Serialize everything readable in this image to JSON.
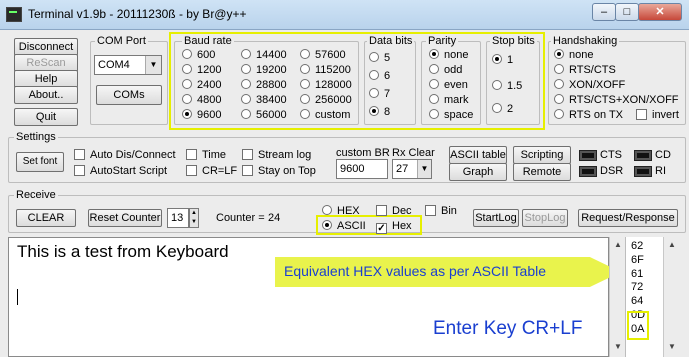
{
  "window": {
    "title": "Terminal v1.9b - 20111230ß - by Br@y++",
    "min": "–",
    "max": "□",
    "close": "✕"
  },
  "left_buttons": {
    "disconnect": "Disconnect",
    "rescan": "ReScan",
    "help": "Help",
    "about": "About..",
    "quit": "Quit"
  },
  "com_port": {
    "label": "COM Port",
    "value": "COM4",
    "coms_button": "COMs"
  },
  "baud": {
    "label": "Baud rate",
    "options": [
      "600",
      "1200",
      "2400",
      "4800",
      "9600",
      "14400",
      "19200",
      "28800",
      "38400",
      "56000",
      "57600",
      "115200",
      "128000",
      "256000",
      "custom"
    ],
    "selected": "9600"
  },
  "data_bits": {
    "label": "Data bits",
    "options": [
      "5",
      "6",
      "7",
      "8"
    ],
    "selected": "8"
  },
  "parity": {
    "label": "Parity",
    "options": [
      "none",
      "odd",
      "even",
      "mark",
      "space"
    ],
    "selected": "none"
  },
  "stop_bits": {
    "label": "Stop bits",
    "options": [
      "1",
      "1.5",
      "2"
    ],
    "selected": "1"
  },
  "handshaking": {
    "label": "Handshaking",
    "options": [
      "none",
      "RTS/CTS",
      "XON/XOFF",
      "RTS/CTS+XON/XOFF",
      "RTS on TX"
    ],
    "selected": "none",
    "invert": "invert"
  },
  "settings": {
    "label": "Settings",
    "set_font": "Set font",
    "auto_dis_connect": "Auto Dis/Connect",
    "autostart_script": "AutoStart Script",
    "time": "Time",
    "cr_lf": "CR=LF",
    "stream_log": "Stream log",
    "stay_on_top": "Stay on Top",
    "custom_br_label": "custom BR",
    "custom_br_value": "9600",
    "rx_clear_label": "Rx Clear",
    "rx_clear_value": "27",
    "ascii_table": "ASCII table",
    "graph": "Graph",
    "scripting": "Scripting",
    "remote": "Remote",
    "leds": [
      "CTS",
      "CD",
      "DSR",
      "RI"
    ]
  },
  "receive": {
    "label": "Receive",
    "clear": "CLEAR",
    "reset_counter": "Reset Counter",
    "counter_spin": "13",
    "counter_label": "Counter =",
    "counter_value": "24",
    "hex": "HEX",
    "ascii": "ASCII",
    "dec": "Dec",
    "hex_cb": "Hex",
    "bin": "Bin",
    "startlog": "StartLog",
    "stoplog": "StopLog",
    "request_response": "Request/Response"
  },
  "terminal": {
    "text": "This is a test from Keyboard"
  },
  "hex_values": [
    "62",
    "6F",
    "61",
    "72",
    "64",
    "0D",
    "0A"
  ],
  "annotations": {
    "hex_note": "Equivalent HEX values as per ASCII Table",
    "enter_note": "Enter Key CR+LF"
  }
}
